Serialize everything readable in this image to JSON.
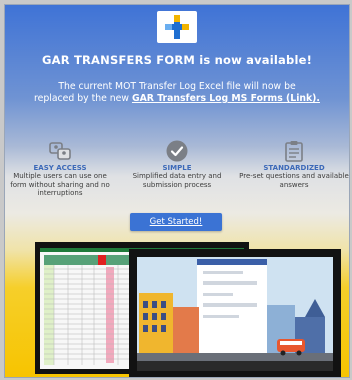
{
  "announcement": {
    "headline": "GAR TRANSFERS FORM is now available!",
    "description_line1": "The current MOT Transfer Log Excel file will now be",
    "description_prefix": "replaced by the new ",
    "description_link": "GAR Transfers Log MS Forms (Link).",
    "cta_label": "Get Started!"
  },
  "features": [
    {
      "icon": "users-share-icon",
      "title": "EASY ACCESS",
      "text": "Multiple users can use one form without sharing and no interruptions"
    },
    {
      "icon": "check-circle-icon",
      "title": "SIMPLE",
      "text": "Simplified data entry and submission process"
    },
    {
      "icon": "clipboard-icon",
      "title": "STANDARDIZED",
      "text": "Pre-set questions and available answers"
    }
  ],
  "colors": {
    "accent": "#3b73d4",
    "banner_top": "#3f73d6",
    "banner_bottom": "#f7c400",
    "feature_title": "#3c69b8"
  }
}
